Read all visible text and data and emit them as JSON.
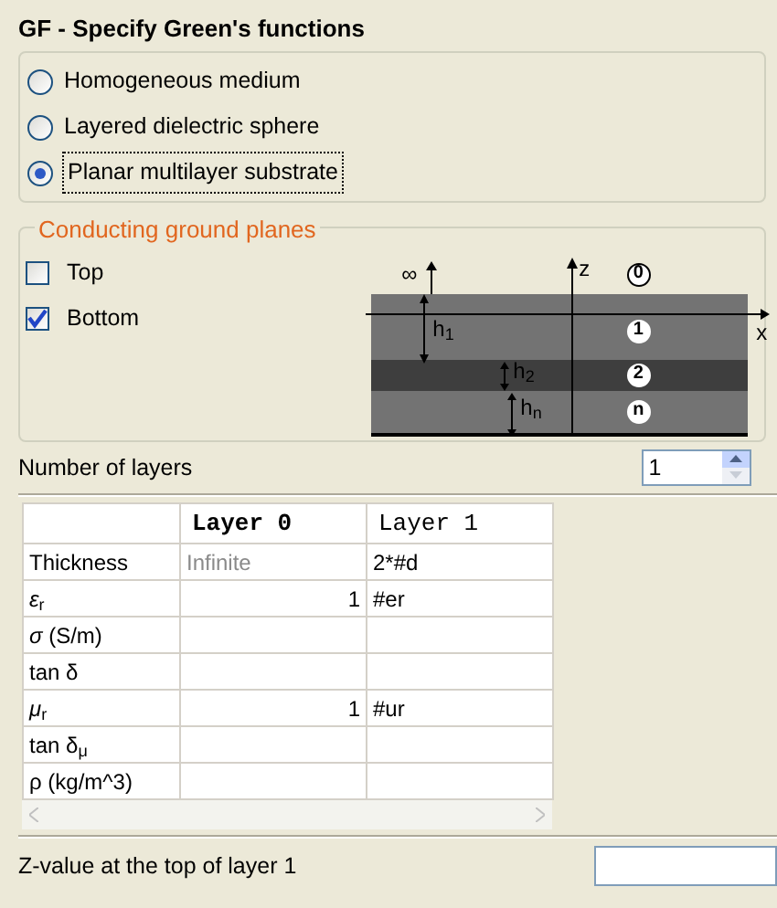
{
  "title": "GF - Specify Green's functions",
  "medium_options": [
    {
      "label": "Homogeneous medium",
      "selected": false
    },
    {
      "label": "Layered dielectric sphere",
      "selected": false
    },
    {
      "label": "Planar multilayer substrate",
      "selected": true
    }
  ],
  "ground_planes": {
    "legend": "Conducting ground planes",
    "options": [
      {
        "label": "Top",
        "checked": false
      },
      {
        "label": "Bottom",
        "checked": true
      }
    ]
  },
  "diagram": {
    "infinity": "∞",
    "z_axis": "z",
    "x_axis": "x",
    "heights": [
      "h$_{1}$",
      "h$_{2}$",
      "h$_{n}$"
    ],
    "layer_marks": [
      "0",
      "1",
      "2",
      "n"
    ]
  },
  "number_of_layers": {
    "label": "Number of layers",
    "value": "1"
  },
  "table": {
    "columns": [
      "Layer 0",
      "Layer 1"
    ],
    "rows": [
      {
        "label": "Thickness",
        "cells": [
          {
            "kind": "fixed",
            "text": "Infinite"
          },
          {
            "kind": "expression",
            "text": "2*#d"
          }
        ]
      },
      {
        "label": "*ε*$_{r}$",
        "cells": [
          {
            "kind": "number",
            "text": "1"
          },
          {
            "kind": "expression",
            "text": "#er"
          }
        ]
      },
      {
        "label": "*σ* (S/m)",
        "cells": [
          {
            "kind": "empty"
          },
          {
            "kind": "empty"
          }
        ]
      },
      {
        "label": "tan δ",
        "cells": [
          {
            "kind": "empty"
          },
          {
            "kind": "empty"
          }
        ]
      },
      {
        "label": "*μ*$_{r}$",
        "cells": [
          {
            "kind": "number",
            "text": "1"
          },
          {
            "kind": "expression",
            "text": "#ur"
          }
        ]
      },
      {
        "label": "tan δ$_{μ}$",
        "cells": [
          {
            "kind": "empty"
          },
          {
            "kind": "empty"
          }
        ]
      },
      {
        "label": "ρ (kg/m^3)",
        "cells": [
          {
            "kind": "empty"
          },
          {
            "kind": "empty"
          }
        ]
      }
    ]
  },
  "z_value": {
    "label": "Z-value at the top of layer 1"
  }
}
